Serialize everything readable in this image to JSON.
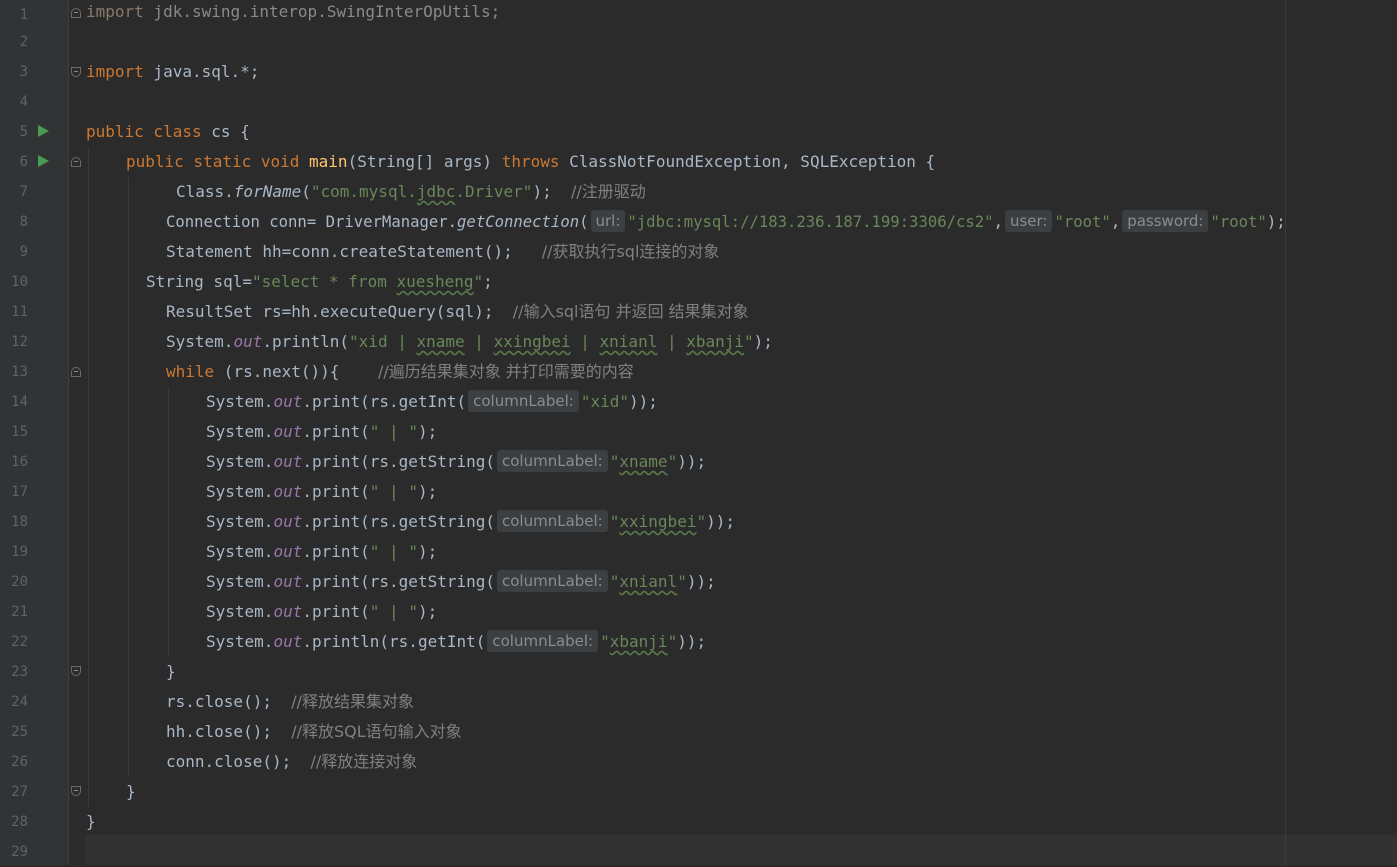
{
  "editor": {
    "line_numbers": [
      "1",
      "2",
      "3",
      "4",
      "5",
      "6",
      "7",
      "8",
      "9",
      "10",
      "11",
      "12",
      "13",
      "14",
      "15",
      "16",
      "17",
      "18",
      "19",
      "20",
      "21",
      "22",
      "23",
      "24",
      "25",
      "26",
      "27",
      "28",
      "29"
    ],
    "hints": {
      "url": "url:",
      "user": "user:",
      "password": "password:",
      "column_label": "columnLabel:"
    },
    "lines": {
      "l1": {
        "kw": "import",
        "rest": " jdk.swing.interop.SwingInterOpUtils;"
      },
      "l3": {
        "kw": "import",
        "rest": " java.sql.*;"
      },
      "l5": {
        "kw": "public class",
        "name": " cs ",
        "brace": "{"
      },
      "l6": {
        "kw1": "public static void",
        "fn": "main",
        "args": "(String[] args) ",
        "kw2": "throws",
        "rest": " ClassNotFoundException, SQLException {"
      },
      "l7": {
        "pre": "Class.",
        "method": "forName",
        "open": "(",
        "str": "\"com.mysql.",
        "sq": "jdbc",
        "str2": ".Driver\"",
        "close": ");",
        "cmt": "//注册驱动"
      },
      "l8": {
        "pre": "Connection conn= DriverManager.",
        "method": "getConnection",
        "open": "(",
        "url": "\"jdbc:mysql://183.236.187.199:3306/cs2\"",
        "comma1": ",",
        "user": "\"root\"",
        "comma2": ",",
        "password": "\"root\"",
        "close": ");"
      },
      "l9": {
        "pre": "Statement hh=conn.createStatement();",
        "cmt": "//获取执行sql连接的对象"
      },
      "l10": {
        "pre": "String sql=",
        "str": "\"select * from ",
        "sq": "xuesheng",
        "str2": "\"",
        "close": ";"
      },
      "l11": {
        "pre": "ResultSet rs=hh.executeQuery(sql);",
        "cmt": "//输入sql语句 并返回 结果集对象"
      },
      "l12": {
        "pre": "System.",
        "out": "out",
        "mid": ".println(",
        "s1": "\"xid | ",
        "w1": "xname",
        "s2": " | ",
        "w2": "xxingbei",
        "s3": " | ",
        "w3": "xnianl",
        "s4": " | ",
        "w4": "xbanji",
        "s5": "\"",
        "close": ");"
      },
      "l13": {
        "kw": "while",
        "rest": " (rs.next()){",
        "cmt": "//遍历结果集对象 并打印需要的内容"
      },
      "l14": {
        "pre": "System.",
        "out": "out",
        "mid": ".print(rs.getInt(",
        "str": "\"xid\"",
        "close": "));"
      },
      "l15": {
        "pre": "System.",
        "out": "out",
        "mid": ".print(",
        "str": "\" | \"",
        "close": ");"
      },
      "l16": {
        "pre": "System.",
        "out": "out",
        "mid": ".print(rs.getString(",
        "q1": "\"",
        "sq": "xname",
        "q2": "\"",
        "close": "));"
      },
      "l17": {
        "pre": "System.",
        "out": "out",
        "mid": ".print(",
        "str": "\" | \"",
        "close": ");"
      },
      "l18": {
        "pre": "System.",
        "out": "out",
        "mid": ".print(rs.getString(",
        "q1": "\"",
        "sq": "xxingbei",
        "q2": "\"",
        "close": "));"
      },
      "l19": {
        "pre": "System.",
        "out": "out",
        "mid": ".print(",
        "str": "\" | \"",
        "close": ");"
      },
      "l20": {
        "pre": "System.",
        "out": "out",
        "mid": ".print(rs.getString(",
        "q1": "\"",
        "sq": "xnianl",
        "q2": "\"",
        "close": "));"
      },
      "l21": {
        "pre": "System.",
        "out": "out",
        "mid": ".print(",
        "str": "\" | \"",
        "close": ");"
      },
      "l22": {
        "pre": "System.",
        "out": "out",
        "mid": ".println(rs.getInt(",
        "q1": "\"",
        "sq": "xbanji",
        "q2": "\"",
        "close": "));"
      },
      "l23": {
        "text": "}"
      },
      "l24": {
        "pre": "rs.close();",
        "cmt": "//释放结果集对象"
      },
      "l25": {
        "pre": "hh.close();",
        "cmt": "//释放SQL语句输入对象"
      },
      "l26": {
        "pre": "conn.close();",
        "cmt": "//释放连接对象"
      },
      "l27": {
        "text": "}"
      },
      "l28": {
        "text": "}"
      }
    }
  }
}
